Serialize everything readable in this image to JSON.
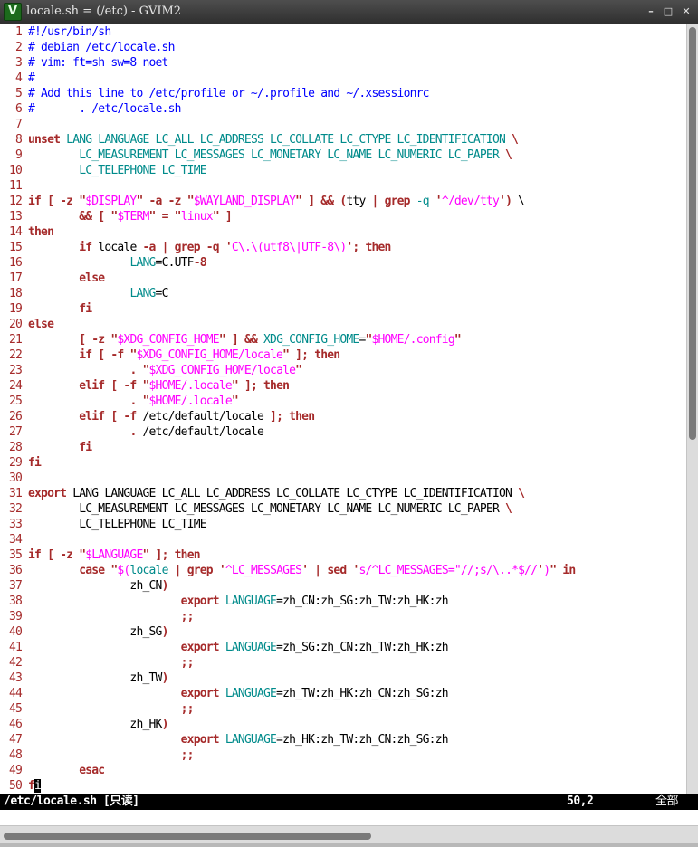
{
  "window": {
    "title": "locale.sh = (/etc) - GVIM2",
    "icon": "vim-icon",
    "icon_glyph": "V",
    "buttons": {
      "minimize_glyph": "–",
      "maximize_glyph": "□",
      "close_glyph": "✕"
    }
  },
  "editor": {
    "lines": [
      {
        "n": "1",
        "segs": [
          [
            "#!/usr/bin/sh",
            "cmt"
          ]
        ]
      },
      {
        "n": "2",
        "segs": [
          [
            "# debian /etc/locale.sh",
            "cmt"
          ]
        ]
      },
      {
        "n": "3",
        "segs": [
          [
            "# vim: ft=sh sw=8 noet",
            "cmt"
          ]
        ]
      },
      {
        "n": "4",
        "segs": [
          [
            "#",
            "cmt"
          ]
        ]
      },
      {
        "n": "5",
        "segs": [
          [
            "# Add this line to /etc/profile or ~/.profile and ~/.xsessionrc",
            "cmt"
          ]
        ]
      },
      {
        "n": "6",
        "segs": [
          [
            "#       . /etc/locale.sh",
            "cmt"
          ]
        ]
      },
      {
        "n": "7",
        "segs": []
      },
      {
        "n": "8",
        "segs": [
          [
            "unset",
            "kw"
          ],
          [
            " ",
            ""
          ],
          [
            "LANG LANGUAGE LC_ALL LC_ADDRESS LC_COLLATE LC_CTYPE LC_IDENTIFICATION",
            "var"
          ],
          [
            " \\",
            "kw"
          ]
        ]
      },
      {
        "n": "9",
        "segs": [
          [
            "        ",
            ""
          ],
          [
            "LC_MEASUREMENT LC_MESSAGES LC_MONETARY LC_NAME LC_NUMERIC LC_PAPER",
            "var"
          ],
          [
            " \\",
            "kw"
          ]
        ]
      },
      {
        "n": "10",
        "segs": [
          [
            "        ",
            ""
          ],
          [
            "LC_TELEPHONE LC_TIME",
            "var"
          ]
        ]
      },
      {
        "n": "11",
        "segs": []
      },
      {
        "n": "12",
        "segs": [
          [
            "if [ -z ",
            "kw"
          ],
          [
            "\"",
            "kw"
          ],
          [
            "$DISPLAY",
            "str"
          ],
          [
            "\"",
            "kw"
          ],
          [
            " -a -z ",
            "kw"
          ],
          [
            "\"",
            "kw"
          ],
          [
            "$WAYLAND_DISPLAY",
            "str"
          ],
          [
            "\"",
            "kw"
          ],
          [
            " ] && ",
            "kw"
          ],
          [
            "(",
            "kw"
          ],
          [
            "tty ",
            ""
          ],
          [
            "| ",
            "kw"
          ],
          [
            "grep",
            "kw"
          ],
          [
            " -q ",
            "var"
          ],
          [
            "'",
            "kw"
          ],
          [
            "^/dev/tty",
            "str"
          ],
          [
            "'",
            "kw"
          ],
          [
            ")",
            "kw"
          ],
          [
            " \\",
            ""
          ]
        ]
      },
      {
        "n": "13",
        "segs": [
          [
            "        ",
            ""
          ],
          [
            "&& [ ",
            "kw"
          ],
          [
            "\"",
            "kw"
          ],
          [
            "$TERM",
            "str"
          ],
          [
            "\"",
            "kw"
          ],
          [
            " = ",
            "kw"
          ],
          [
            "\"",
            "kw"
          ],
          [
            "linux",
            "str"
          ],
          [
            "\"",
            "kw"
          ],
          [
            " ]",
            "kw"
          ]
        ]
      },
      {
        "n": "14",
        "segs": [
          [
            "then",
            "kw"
          ]
        ]
      },
      {
        "n": "15",
        "segs": [
          [
            "        ",
            ""
          ],
          [
            "if",
            "kw"
          ],
          [
            " locale ",
            ""
          ],
          [
            "-a | grep -q ",
            "kw"
          ],
          [
            "'",
            "kw"
          ],
          [
            "C\\.\\(utf8\\|UTF-8\\)",
            "str"
          ],
          [
            "'",
            "kw"
          ],
          [
            "; then",
            "kw"
          ]
        ]
      },
      {
        "n": "16",
        "segs": [
          [
            "                ",
            ""
          ],
          [
            "LANG",
            "var"
          ],
          [
            "=C.UTF",
            ""
          ],
          [
            "-8",
            "kw"
          ]
        ]
      },
      {
        "n": "17",
        "segs": [
          [
            "        ",
            ""
          ],
          [
            "else",
            "kw"
          ]
        ]
      },
      {
        "n": "18",
        "segs": [
          [
            "                ",
            ""
          ],
          [
            "LANG",
            "var"
          ],
          [
            "=C",
            ""
          ]
        ]
      },
      {
        "n": "19",
        "segs": [
          [
            "        ",
            ""
          ],
          [
            "fi",
            "kw"
          ]
        ]
      },
      {
        "n": "20",
        "segs": [
          [
            "else",
            "kw"
          ]
        ]
      },
      {
        "n": "21",
        "segs": [
          [
            "        ",
            ""
          ],
          [
            "[ -z ",
            "kw"
          ],
          [
            "\"",
            "kw"
          ],
          [
            "$XDG_CONFIG_HOME",
            "str"
          ],
          [
            "\"",
            "kw"
          ],
          [
            " ] && ",
            "kw"
          ],
          [
            "XDG_CONFIG_HOME",
            "var"
          ],
          [
            "=",
            ""
          ],
          [
            "\"",
            "kw"
          ],
          [
            "$HOME",
            "str"
          ],
          [
            "/.config",
            "str"
          ],
          [
            "\"",
            "kw"
          ]
        ]
      },
      {
        "n": "22",
        "segs": [
          [
            "        ",
            ""
          ],
          [
            "if [ -f ",
            "kw"
          ],
          [
            "\"",
            "kw"
          ],
          [
            "$XDG_CONFIG_HOME/locale",
            "str"
          ],
          [
            "\"",
            "kw"
          ],
          [
            " ]; then",
            "kw"
          ]
        ]
      },
      {
        "n": "23",
        "segs": [
          [
            "                ",
            ""
          ],
          [
            ". ",
            "kw"
          ],
          [
            "\"",
            "kw"
          ],
          [
            "$XDG_CONFIG_HOME/locale",
            "str"
          ],
          [
            "\"",
            "kw"
          ]
        ]
      },
      {
        "n": "24",
        "segs": [
          [
            "        ",
            ""
          ],
          [
            "elif [ -f ",
            "kw"
          ],
          [
            "\"",
            "kw"
          ],
          [
            "$HOME/.locale",
            "str"
          ],
          [
            "\"",
            "kw"
          ],
          [
            " ]; then",
            "kw"
          ]
        ]
      },
      {
        "n": "25",
        "segs": [
          [
            "                ",
            ""
          ],
          [
            ". ",
            "kw"
          ],
          [
            "\"",
            "kw"
          ],
          [
            "$HOME/.locale",
            "str"
          ],
          [
            "\"",
            "kw"
          ]
        ]
      },
      {
        "n": "26",
        "segs": [
          [
            "        ",
            ""
          ],
          [
            "elif [ -f ",
            "kw"
          ],
          [
            "/etc/default/locale ",
            ""
          ],
          [
            "]; then",
            "kw"
          ]
        ]
      },
      {
        "n": "27",
        "segs": [
          [
            "                ",
            ""
          ],
          [
            ". ",
            "kw"
          ],
          [
            "/etc/default/locale",
            ""
          ]
        ]
      },
      {
        "n": "28",
        "segs": [
          [
            "        ",
            ""
          ],
          [
            "fi",
            "kw"
          ]
        ]
      },
      {
        "n": "29",
        "segs": [
          [
            "fi",
            "kw"
          ]
        ]
      },
      {
        "n": "30",
        "segs": []
      },
      {
        "n": "31",
        "segs": [
          [
            "export",
            "kw"
          ],
          [
            " LANG LANGUAGE LC_ALL LC_ADDRESS LC_COLLATE LC_CTYPE LC_IDENTIFICATION",
            ""
          ],
          [
            " \\",
            "kw"
          ]
        ]
      },
      {
        "n": "32",
        "segs": [
          [
            "        LC_MEASUREMENT LC_MESSAGES LC_MONETARY LC_NAME LC_NUMERIC LC_PAPER",
            ""
          ],
          [
            " \\",
            "kw"
          ]
        ]
      },
      {
        "n": "33",
        "segs": [
          [
            "        LC_TELEPHONE LC_TIME",
            ""
          ]
        ]
      },
      {
        "n": "34",
        "segs": []
      },
      {
        "n": "35",
        "segs": [
          [
            "if [ -z ",
            "kw"
          ],
          [
            "\"",
            "kw"
          ],
          [
            "$LANGUAGE",
            "str"
          ],
          [
            "\"",
            "kw"
          ],
          [
            " ]; then",
            "kw"
          ]
        ]
      },
      {
        "n": "36",
        "segs": [
          [
            "        ",
            ""
          ],
          [
            "case ",
            "kw"
          ],
          [
            "\"",
            "kw"
          ],
          [
            "$(",
            "str"
          ],
          [
            "locale",
            "var"
          ],
          [
            " | ",
            "kw"
          ],
          [
            "grep ",
            "kw"
          ],
          [
            "'",
            "kw"
          ],
          [
            "^LC_MESSAGES",
            "str"
          ],
          [
            "'",
            "kw"
          ],
          [
            " | ",
            "kw"
          ],
          [
            "sed ",
            "kw"
          ],
          [
            "'",
            "kw"
          ],
          [
            "s/^LC_MESSAGES=\"//;s/\\..*$//",
            "str"
          ],
          [
            "'",
            "kw"
          ],
          [
            ")",
            "str"
          ],
          [
            "\"",
            "kw"
          ],
          [
            " in",
            "kw"
          ]
        ]
      },
      {
        "n": "37",
        "segs": [
          [
            "                zh_CN",
            ""
          ],
          [
            ")",
            "kw"
          ]
        ]
      },
      {
        "n": "38",
        "segs": [
          [
            "                        ",
            ""
          ],
          [
            "export ",
            "kw"
          ],
          [
            "LANGUAGE",
            "var"
          ],
          [
            "=zh_CN:zh_SG:zh_TW:zh_HK:zh",
            ""
          ]
        ]
      },
      {
        "n": "39",
        "segs": [
          [
            "                        ",
            ""
          ],
          [
            ";;",
            "kw"
          ]
        ]
      },
      {
        "n": "40",
        "segs": [
          [
            "                zh_SG",
            ""
          ],
          [
            ")",
            "kw"
          ]
        ]
      },
      {
        "n": "41",
        "segs": [
          [
            "                        ",
            ""
          ],
          [
            "export ",
            "kw"
          ],
          [
            "LANGUAGE",
            "var"
          ],
          [
            "=zh_SG:zh_CN:zh_TW:zh_HK:zh",
            ""
          ]
        ]
      },
      {
        "n": "42",
        "segs": [
          [
            "                        ",
            ""
          ],
          [
            ";;",
            "kw"
          ]
        ]
      },
      {
        "n": "43",
        "segs": [
          [
            "                zh_TW",
            ""
          ],
          [
            ")",
            "kw"
          ]
        ]
      },
      {
        "n": "44",
        "segs": [
          [
            "                        ",
            ""
          ],
          [
            "export ",
            "kw"
          ],
          [
            "LANGUAGE",
            "var"
          ],
          [
            "=zh_TW:zh_HK:zh_CN:zh_SG:zh",
            ""
          ]
        ]
      },
      {
        "n": "45",
        "segs": [
          [
            "                        ",
            ""
          ],
          [
            ";;",
            "kw"
          ]
        ]
      },
      {
        "n": "46",
        "segs": [
          [
            "                zh_HK",
            ""
          ],
          [
            ")",
            "kw"
          ]
        ]
      },
      {
        "n": "47",
        "segs": [
          [
            "                        ",
            ""
          ],
          [
            "export ",
            "kw"
          ],
          [
            "LANGUAGE",
            "var"
          ],
          [
            "=zh_HK:zh_TW:zh_CN:zh_SG:zh",
            ""
          ]
        ]
      },
      {
        "n": "48",
        "segs": [
          [
            "                        ",
            ""
          ],
          [
            ";;",
            "kw"
          ]
        ]
      },
      {
        "n": "49",
        "segs": [
          [
            "        ",
            ""
          ],
          [
            "esac",
            "kw"
          ]
        ]
      },
      {
        "n": "50",
        "segs": [
          [
            "f",
            "kw"
          ],
          [
            "i",
            "cursor"
          ]
        ]
      }
    ],
    "colors": {
      "line_number": "#a52a2a",
      "keyword": "#a52a2a",
      "comment": "#0000ff",
      "string": "#ff00ff",
      "identifier": "#008b8b"
    }
  },
  "statusline": {
    "file": "/etc/locale.sh [只读]",
    "position": "50,2",
    "scroll": "全部"
  }
}
